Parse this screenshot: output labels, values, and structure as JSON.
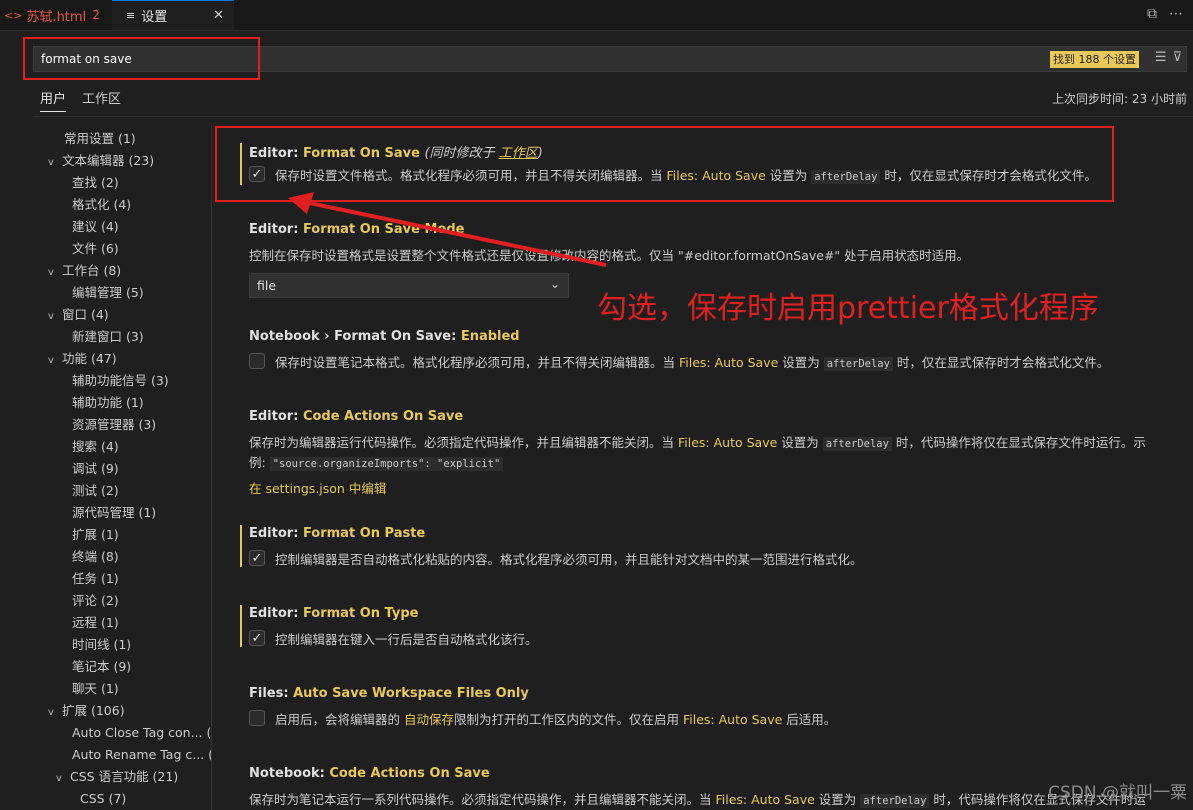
{
  "tabs": [
    {
      "icon": "<>",
      "label": "苏轼.html",
      "badge": "2"
    },
    {
      "icon": "≡",
      "label": "设置",
      "close": "✕"
    }
  ],
  "search": {
    "value": "format on save",
    "count_badge": "找到 188 个设置"
  },
  "scope_tabs": {
    "user": "用户",
    "workspace": "工作区"
  },
  "sync_status": "上次同步时间: 23 小时前",
  "toc": [
    {
      "label": "常用设置 (1)",
      "level": 0,
      "chevron": ""
    },
    {
      "label": "文本编辑器 (23)",
      "level": 0,
      "chevron": "v"
    },
    {
      "label": "查找 (2)",
      "level": 1,
      "chevron": ""
    },
    {
      "label": "格式化 (4)",
      "level": 1,
      "chevron": ""
    },
    {
      "label": "建议 (4)",
      "level": 1,
      "chevron": ""
    },
    {
      "label": "文件 (6)",
      "level": 1,
      "chevron": ""
    },
    {
      "label": "工作台 (8)",
      "level": 0,
      "chevron": "v"
    },
    {
      "label": "编辑管理 (5)",
      "level": 1,
      "chevron": ""
    },
    {
      "label": "窗口 (4)",
      "level": 0,
      "chevron": "v"
    },
    {
      "label": "新建窗口 (3)",
      "level": 1,
      "chevron": ""
    },
    {
      "label": "功能 (47)",
      "level": 0,
      "chevron": "v"
    },
    {
      "label": "辅助功能信号 (3)",
      "level": 1,
      "chevron": ""
    },
    {
      "label": "辅助功能 (1)",
      "level": 1,
      "chevron": ""
    },
    {
      "label": "资源管理器 (3)",
      "level": 1,
      "chevron": ""
    },
    {
      "label": "搜索 (4)",
      "level": 1,
      "chevron": ""
    },
    {
      "label": "调试 (9)",
      "level": 1,
      "chevron": ""
    },
    {
      "label": "测试 (2)",
      "level": 1,
      "chevron": ""
    },
    {
      "label": "源代码管理 (1)",
      "level": 1,
      "chevron": ""
    },
    {
      "label": "扩展 (1)",
      "level": 1,
      "chevron": ""
    },
    {
      "label": "终端 (8)",
      "level": 1,
      "chevron": ""
    },
    {
      "label": "任务 (1)",
      "level": 1,
      "chevron": ""
    },
    {
      "label": "评论 (2)",
      "level": 1,
      "chevron": ""
    },
    {
      "label": "远程 (1)",
      "level": 1,
      "chevron": ""
    },
    {
      "label": "时间线 (1)",
      "level": 1,
      "chevron": ""
    },
    {
      "label": "笔记本 (9)",
      "level": 1,
      "chevron": ""
    },
    {
      "label": "聊天 (1)",
      "level": 1,
      "chevron": ""
    },
    {
      "label": "扩展 (106)",
      "level": 0,
      "chevron": "v"
    },
    {
      "label": "Auto Close Tag con... (2)",
      "level": 1,
      "chevron": ""
    },
    {
      "label": "Auto Rename Tag c... (1)",
      "level": 1,
      "chevron": ""
    },
    {
      "label": "CSS 语言功能 (21)",
      "level": 1,
      "chevron": "v"
    },
    {
      "label": "CSS (7)",
      "level": 2,
      "chevron": ""
    }
  ],
  "settings": {
    "format_on_save": {
      "category": "Editor: ",
      "name": "Format On Save",
      "note_prefix": "(同时修改于 ",
      "note_link": "工作区",
      "note_suffix": ")",
      "desc_pre": "保存时设置文件格式。格式化程序必须可用，并且不得关闭编辑器。当 ",
      "desc_link": "Files: Auto Save",
      "desc_mid": " 设置为 ",
      "desc_code": "afterDelay",
      "desc_post": " 时，仅在显式保存时才会格式化文件。",
      "checked": true
    },
    "format_on_save_mode": {
      "category": "Editor: ",
      "name": "Format On Save Mode",
      "desc": "控制在保存时设置格式是设置整个文件格式还是仅设置修改内容的格式。仅当 \"#editor.formatOnSave#\" 处于启用状态时适用。",
      "value": "file"
    },
    "notebook_format_on_save": {
      "category": "Notebook › Format On Save: ",
      "name": "Enabled",
      "desc_pre": "保存时设置笔记本格式。格式化程序必须可用，并且不得关闭编辑器。当 ",
      "desc_link": "Files: Auto Save",
      "desc_mid": " 设置为 ",
      "desc_code": "afterDelay",
      "desc_post": " 时，仅在显式保存时才会格式化文件。",
      "checked": false
    },
    "code_actions_on_save": {
      "category": "Editor: ",
      "name": "Code Actions On Save",
      "desc_pre": "保存时为编辑器运行代码操作。必须指定代码操作，并且编辑器不能关闭。当 ",
      "desc_link": "Files: Auto Save",
      "desc_mid": " 设置为 ",
      "desc_code": "afterDelay",
      "desc_post": " 时，代码操作将仅在显式保存文件时运行。示",
      "desc_line2": "例: ",
      "example_code": "\"source.organizeImports\": \"explicit\"",
      "edit_link": "在 settings.json 中编辑"
    },
    "format_on_paste": {
      "category": "Editor: ",
      "name": "Format On Paste",
      "desc": "控制编辑器是否自动格式化粘贴的内容。格式化程序必须可用，并且能针对文档中的某一范围进行格式化。",
      "checked": true
    },
    "format_on_type": {
      "category": "Editor: ",
      "name": "Format On Type",
      "desc": "控制编辑器在键入一行后是否自动格式化该行。",
      "checked": true
    },
    "auto_save_workspace": {
      "category": "Files: ",
      "name": "Auto Save Workspace Files Only",
      "desc_pre": "启用后，会将编辑器的 ",
      "desc_link1": "自动保存",
      "desc_mid": "限制为打开的工作区内的文件。仅在启用 ",
      "desc_link2": "Files: Auto Save",
      "desc_post": " 后适用。",
      "checked": false
    },
    "notebook_code_actions": {
      "category": "Notebook: ",
      "name": "Code Actions On Save",
      "desc_pre": "保存时为笔记本运行一系列代码操作。必须指定代码操作，并且编辑器不能关闭。当 ",
      "desc_link": "Files: Auto Save",
      "desc_mid": " 设置为 ",
      "desc_code": "afterDelay",
      "desc_post": " 时，代码操作将仅在显式保存文件时运"
    }
  },
  "annotation": "勾选，保存时启用prettier格式化程序",
  "watermark": "CSDN @就叫一粟",
  "colors": {
    "accent": "#e8c95a",
    "annotation_red": "#e02020",
    "background": "#1f1f1f"
  }
}
